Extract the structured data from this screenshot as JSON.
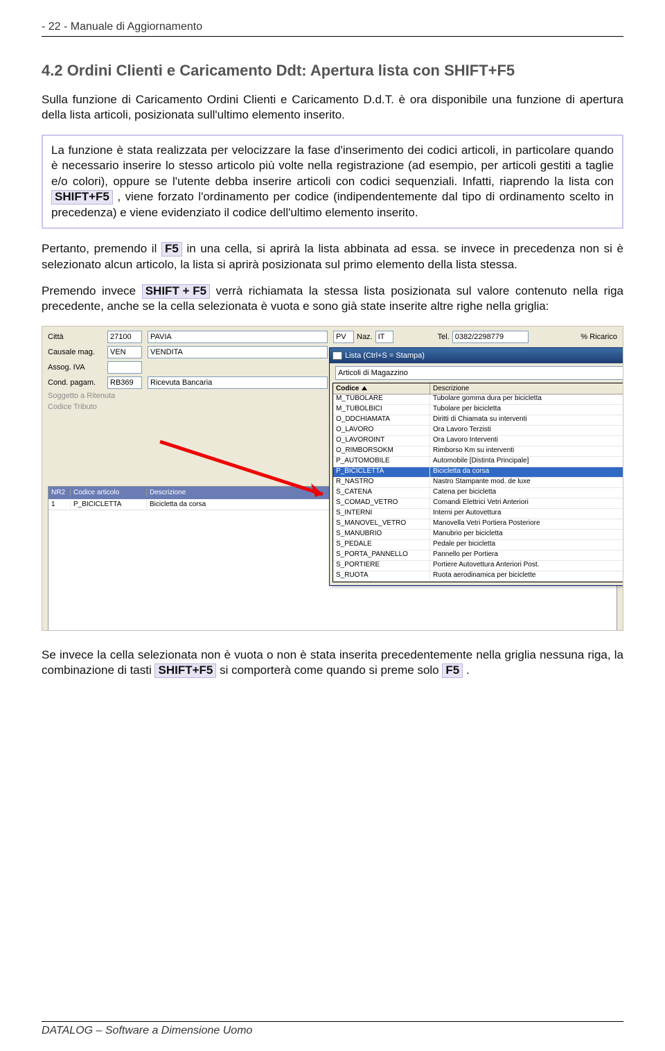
{
  "header": "- 22 -  Manuale di Aggiornamento",
  "section_title": "4.2  Ordini Clienti e Caricamento Ddt: Apertura lista con SHIFT+F5",
  "para_intro": "Sulla funzione di Caricamento Ordini Clienti e Caricamento D.d.T. è ora disponibile una funzione di apertura della lista articoli, posizionata sull'ultimo elemento inserito.",
  "callout_a": "La funzione è stata realizzata per velocizzare la fase d'inserimento dei codici articoli, in particolare quando è necessario inserire lo stesso articolo più volte nella registrazione (ad esempio, per articoli gestiti a taglie e/o colori), oppure se l'utente debba inserire articoli con codici sequenziali.  Infatti, riaprendo la lista con ",
  "callout_kbd1": "SHIFT+F5",
  "callout_b": ", viene forzato l'ordinamento per codice (indipendentemente dal tipo di ordinamento scelto in precedenza) e viene evidenziato il codice dell'ultimo elemento inserito.",
  "para2a": "Pertanto, premendo il ",
  "kbd_f5": "F5",
  "para2b": " in una cella, si aprirà la lista abbinata ad essa. se invece in precedenza non si è selezionato alcun articolo, la lista si aprirà posizionata sul primo elemento della lista stessa.",
  "para3a": "Premendo invece ",
  "kbd_shiftf5_long": "SHIFT + F5",
  "para3b": " verrà richiamata la stessa lista posizionata sul valore contenuto nella riga precedente, anche se la cella selezionata è vuota e sono già state inserite altre righe nella griglia:",
  "para4a": "Se invece la cella selezionata non è vuota o non è stata inserita precedentemente nella griglia nessuna riga, la combinazione di tasti ",
  "kbd_shiftf5_short": "SHIFT+F5",
  "para4b": " si comporterà come quando si preme solo ",
  "kbd_f5_2": "F5",
  "para4c": ".",
  "footer": "DATALOG – Software a Dimensione Uomo",
  "ui": {
    "labels": {
      "citta": "Città",
      "cap": "27100",
      "city_name": "PAVIA",
      "prov": "PV",
      "naz_lbl": "Naz.",
      "naz": "IT",
      "tel_lbl": "Tel.",
      "tel": "0382/2298779",
      "ricarico": "% Ricarico",
      "causale": "Causale mag.",
      "causale_code": "VEN",
      "causale_desc": "VENDITA",
      "assog": "Assog. IVA",
      "cond": "Cond. pagam.",
      "cond_code": "RB369",
      "cond_desc": "Ricevuta Bancaria",
      "soggetto": "Soggetto a Ritenuta",
      "codtrib": "Codice Tributo"
    },
    "grid": {
      "h_nr": "NR2",
      "h_cod": "Codice articolo",
      "h_desc": "Descrizione",
      "row_nr": "1",
      "row_cod": "P_BICICLETTA",
      "row_desc": "Bicicletta da corsa"
    },
    "popup": {
      "title": "Lista  (Ctrl+S = Stampa)",
      "combo": "Articoli di Magazzino",
      "h_code": "Codice",
      "h_desc": "Descrizione",
      "rows": [
        {
          "c": "M_TUBOLARE",
          "d": "Tubolare gomma dura per bicicletta"
        },
        {
          "c": "M_TUBOLBICI",
          "d": "Tubolare per bicicletta"
        },
        {
          "c": "O_DDCHIAMATA",
          "d": "Diritti di Chiamata su interventi"
        },
        {
          "c": "O_LAVORO",
          "d": "Ora Lavoro Terzisti"
        },
        {
          "c": "O_LAVOROINT",
          "d": "Ora Lavoro Interventi"
        },
        {
          "c": "O_RIMBORSOKM",
          "d": "Rimborso Km su interventi"
        },
        {
          "c": "P_AUTOMOBILE",
          "d": "Automobile [Distinta Principale]"
        },
        {
          "c": "P_BICICLETTA",
          "d": "Bicicletta da corsa"
        },
        {
          "c": "R_NASTRO",
          "d": "Nastro Stampante mod. de luxe"
        },
        {
          "c": "S_CATENA",
          "d": "Catena per bicicletta"
        },
        {
          "c": "S_COMAD_VETRO",
          "d": "Comandi Elettrici Vetri Anteriori"
        },
        {
          "c": "S_INTERNI",
          "d": "Interni per Autovettura"
        },
        {
          "c": "S_MANOVEL_VETRO",
          "d": "Manovella Vetri Portiera Posteriore"
        },
        {
          "c": "S_MANUBRIO",
          "d": "Manubrio per bicicletta"
        },
        {
          "c": "S_PEDALE",
          "d": "Pedale per bicicletta"
        },
        {
          "c": "S_PORTA_PANNELLO",
          "d": "Pannello per Portiera"
        },
        {
          "c": "S_PORTIERE",
          "d": "Portiere Autovettura Anteriori Post."
        },
        {
          "c": "S_RUOTA",
          "d": "Ruota aerodinamica per biciclette"
        }
      ],
      "selected": 7
    }
  }
}
